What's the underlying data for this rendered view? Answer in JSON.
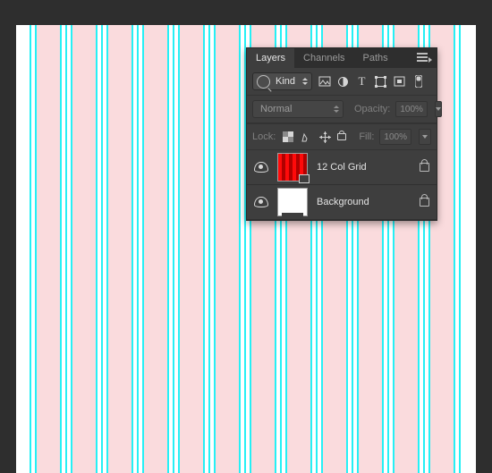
{
  "tabs": {
    "layers": "Layers",
    "channels": "Channels",
    "paths": "Paths"
  },
  "filter": {
    "kind": "Kind"
  },
  "blend": {
    "mode": "Normal",
    "opacity_label": "Opacity:",
    "opacity_value": "100%"
  },
  "lock": {
    "label": "Lock:",
    "fill_label": "Fill:",
    "fill_value": "100%"
  },
  "layers_list": [
    {
      "name": "12 Col Grid"
    },
    {
      "name": "Background"
    }
  ]
}
